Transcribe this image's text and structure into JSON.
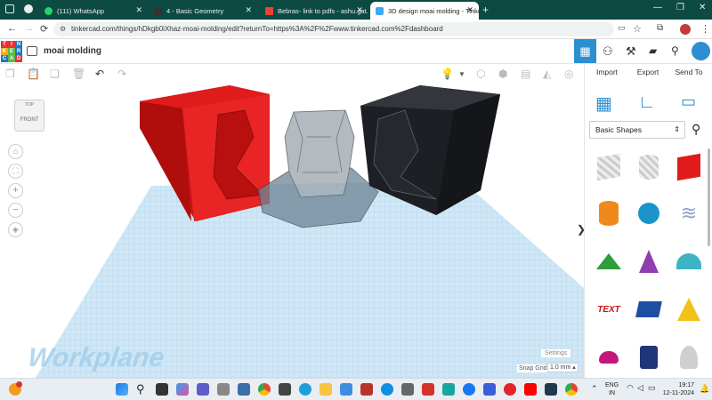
{
  "browser": {
    "tabs": [
      {
        "label": "(111) WhatsApp",
        "icon": "whatsapp-icon",
        "color": "#25d366"
      },
      {
        "label": "4 - Basic Geometry",
        "icon": "dol-icon",
        "color": "#333333"
      },
      {
        "label": "Bebras- link to pdfs - ashu.gat...",
        "icon": "gmail-icon",
        "color": "#ea4335"
      },
      {
        "label": "3D design moai molding - Tinke...",
        "icon": "tinkercad-icon",
        "color": "#3fa9f5"
      }
    ],
    "url": "tinkercad.com/things/hDkgb0iXhaz-moai-molding/edit?returnTo=https%3A%2F%2Fwww.tinkercad.com%2Fdashboard"
  },
  "app": {
    "logo_letters": [
      "T",
      "I",
      "N",
      "K",
      "E",
      "R",
      "C",
      "A",
      "D"
    ],
    "design_title": "moai molding",
    "panel_buttons": [
      "Import",
      "Export",
      "Send To"
    ],
    "shape_category": "Basic Shapes",
    "viewcube": {
      "top": "TOP",
      "front": "FRONT"
    },
    "workplane_label": "Workplane",
    "settings_label": "Settings",
    "snap_grid_label": "Snap Grid",
    "snap_grid_value": "1.0 mm"
  },
  "shapes": [
    "box-striped",
    "cylinder-striped",
    "box-red",
    "cylinder-orange",
    "sphere-blue",
    "scribble",
    "roof-green",
    "cone-purple",
    "round-roof-teal",
    "text-red",
    "prism-blue",
    "pyramid-yellow",
    "half-sphere-pink",
    "polygon-navy",
    "paraboloid-grey"
  ],
  "colors": {
    "accent": "#2d8ed1",
    "tab_bar": "#0d4a42",
    "mold_red": "#e01b1b",
    "mold_black": "#1e1f24"
  },
  "taskbar": {
    "lang_top": "ENG",
    "lang_bottom": "IN",
    "time": "19:17",
    "date": "12-11-2024"
  }
}
